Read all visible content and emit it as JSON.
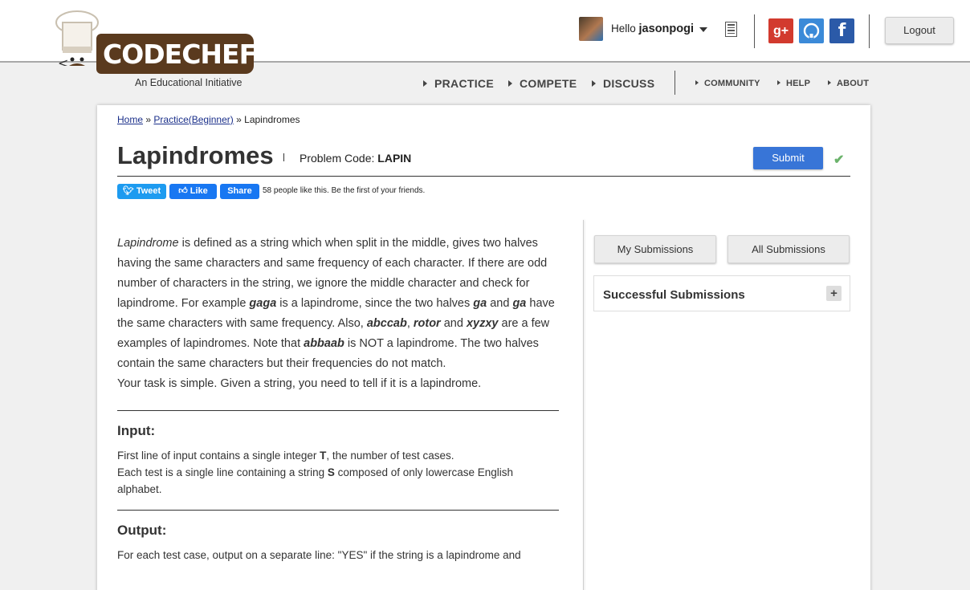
{
  "brand": {
    "logo_text": "CODECHEF",
    "tagline": "An Educational Initiative",
    "colors": {
      "logo_brown": "#5a3a1e",
      "accent_blue": "#3875d7",
      "link": "#1a2f8a"
    }
  },
  "header": {
    "greeting": "Hello",
    "username": "jasonpogi",
    "logout_label": "Logout",
    "social": [
      {
        "icon": "google-plus-icon",
        "glyph": "g+"
      },
      {
        "icon": "github-icon",
        "glyph": ""
      },
      {
        "icon": "facebook-icon",
        "glyph": "f"
      }
    ]
  },
  "nav": {
    "main": [
      "PRACTICE",
      "COMPETE",
      "DISCUSS"
    ],
    "secondary": [
      "COMMUNITY",
      "HELP",
      "ABOUT"
    ]
  },
  "breadcrumb": {
    "items": [
      "Home",
      "Practice(Beginner)"
    ],
    "separator": "»",
    "current": "Lapindromes"
  },
  "problem": {
    "title": "Lapindromes",
    "code_label": "Problem Code:",
    "code": "LAPIN",
    "submit_label": "Submit"
  },
  "social_share": {
    "tweet_label": "Tweet",
    "like_label": "Like",
    "share_label": "Share",
    "like_text": "58 people like this. Be the first of your friends."
  },
  "statement": {
    "p1": {
      "term": "Lapindrome",
      "t1": " is defined as a string which when split in the middle, gives two halves having the same characters and same frequency of each character. If there are odd number of characters in the string, we ignore the middle character and check for lapindrome. For example ",
      "ex1": "gaga",
      "t2": " is a lapindrome, since the two halves ",
      "ex2": "ga",
      "t3": " and ",
      "ex3": "ga",
      "t4": " have the same characters with same frequency. Also, ",
      "ex4": "abccab",
      "t5": ", ",
      "ex5": "rotor",
      "t6": " and ",
      "ex6": "xyzxy",
      "t7": " are a few examples of lapindromes. Note that ",
      "ex7": "abbaab",
      "t8": " is NOT a lapindrome. The two halves contain the same characters but their frequencies do not match."
    },
    "p2": "Your task is simple. Given a string, you need to tell if it is a lapindrome."
  },
  "input_section": {
    "heading": "Input:",
    "l1a": "First line of input contains a single integer ",
    "l1v": "T",
    "l1b": ", the number of test cases.",
    "l2a": "Each test is a single line containing a string ",
    "l2v": "S",
    "l2b": " composed of only lowercase English alphabet."
  },
  "output_section": {
    "heading": "Output:",
    "text": "For each test case, output on a separate line: \"YES\" if the string is a lapindrome and"
  },
  "sidebar": {
    "my_submissions": "My Submissions",
    "all_submissions": "All Submissions",
    "successful_label": "Successful Submissions",
    "expand_glyph": "+"
  }
}
